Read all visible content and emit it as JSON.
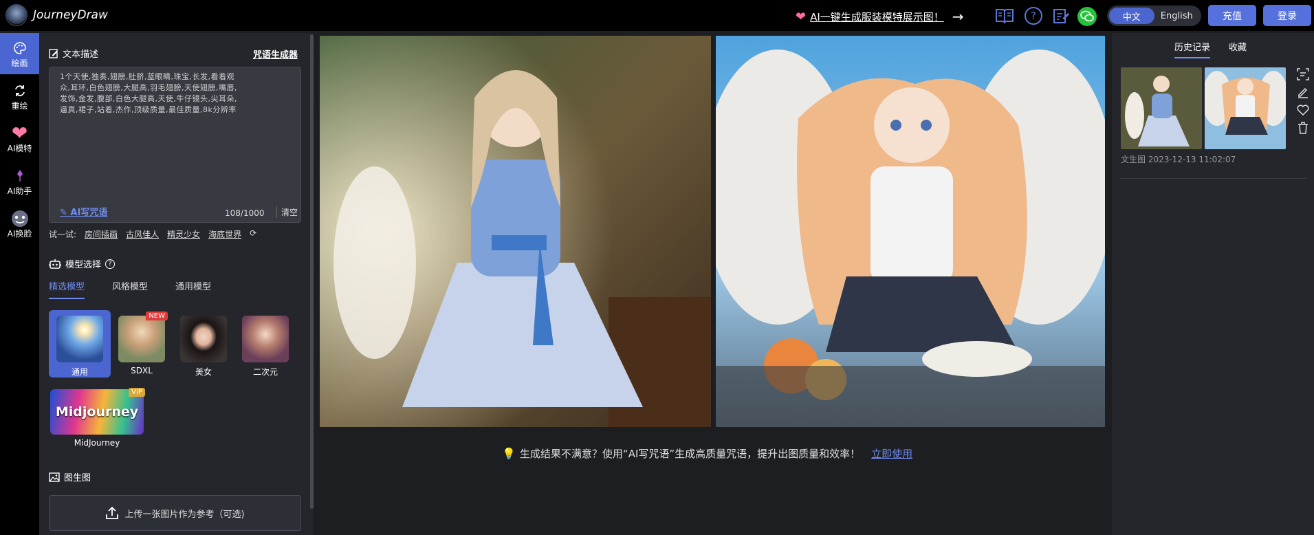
{
  "header": {
    "brand": "JourneyDraw",
    "promo_text": "AI一键生成服装模特展示图！",
    "lang_zh": "中文",
    "lang_en": "English",
    "recharge": "充值",
    "login": "登录"
  },
  "nav": {
    "items": [
      {
        "label": "绘画",
        "icon": "palette-icon"
      },
      {
        "label": "重绘",
        "icon": "refresh-icon"
      },
      {
        "label": "AI模特",
        "icon": "heart-icon"
      },
      {
        "label": "AI助手",
        "icon": "assistant-icon"
      },
      {
        "label": "AI换脸",
        "icon": "face-swap-icon"
      }
    ]
  },
  "prompt": {
    "section_title": "文本描述",
    "generator_link": "咒语生成器",
    "text_line1": "1个天使,独奏,翅膀,肚脐,蓝眼睛,珠宝,长发,看着观",
    "text_line2": "众,耳环,白色翅膀,大腿高,羽毛翅膀,天使翅膀,嘴唇,",
    "text_line3": "发饰,金发,腹部,白色大腿高,天使,牛仔镜头,尖耳朵,",
    "text_line4": "逼真,裙子,站着,杰作,顶级质量,最佳质量,8k分辨率",
    "ai_write": "AI写咒语",
    "counter": "108/1000",
    "clear": "清空"
  },
  "try": {
    "label": "试一试:",
    "items": [
      "房间插画",
      "古风佳人",
      "精灵少女",
      "海底世界"
    ]
  },
  "model_section": {
    "title": "模型选择",
    "tabs": [
      "精选模型",
      "风格模型",
      "通用模型"
    ],
    "models": [
      {
        "label": "通用",
        "badge": ""
      },
      {
        "label": "SDXL",
        "badge": "NEW"
      },
      {
        "label": "美女",
        "badge": ""
      },
      {
        "label": "二次元",
        "badge": ""
      },
      {
        "label": "MidJourney",
        "badge": "VIP",
        "thumb_text": "Midjourney"
      }
    ]
  },
  "img2img": {
    "title": "图生图",
    "upload_label": "上传一张图片作为参考（可选)"
  },
  "main": {
    "tip": "生成结果不满意？使用“AI写咒语”生成高质量咒语，提升出图质量和效率！",
    "tip_link": "立即使用"
  },
  "history": {
    "tabs": [
      "历史记录",
      "收藏"
    ],
    "date": "文生图 2023-12-13 11:02:07"
  },
  "colors": {
    "accent": "#4b66d1",
    "link": "#6f8cf0",
    "new_badge": "#e23b3b",
    "vip_badge": "#d8a93a"
  }
}
